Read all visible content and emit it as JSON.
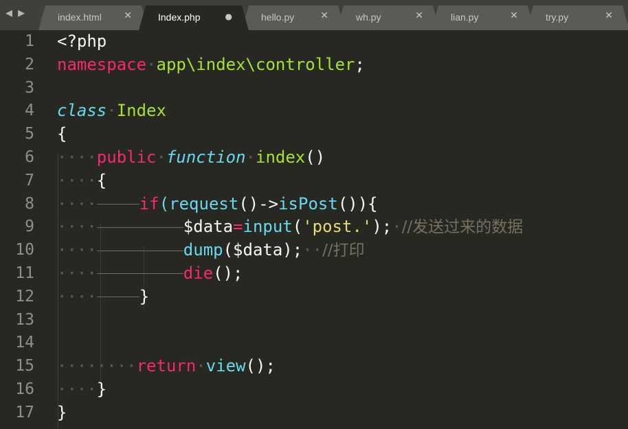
{
  "tabs": [
    {
      "label": "index.html",
      "close": "✕",
      "active": false
    },
    {
      "label": "Index.php",
      "close": "●",
      "active": true
    },
    {
      "label": "hello.py",
      "close": "✕",
      "active": false
    },
    {
      "label": "wh.py",
      "close": "✕",
      "active": false
    },
    {
      "label": "lian.py",
      "close": "✕",
      "active": false
    },
    {
      "label": "try.py",
      "close": "✕",
      "active": false
    }
  ],
  "nav": "◀ ▶",
  "line_numbers": [
    "1",
    "2",
    "3",
    "4",
    "5",
    "6",
    "7",
    "8",
    "9",
    "10",
    "11",
    "12",
    "13",
    "14",
    "15",
    "16",
    "17"
  ],
  "code": {
    "l1": "<?php",
    "l2_kw": "namespace",
    "l2_ns": "app\\index\\controller",
    "l2_end": ";",
    "l4_kw": "class",
    "l4_name": "Index",
    "l5": "{",
    "l6_kw": "public",
    "l6_fn": "function",
    "l6_name": "index",
    "l6_paren": "()",
    "l7": "{",
    "l8_if": "if",
    "l8_p1": "(",
    "l8_req": "request",
    "l8_p2": "()->",
    "l8_ispost": "isPost",
    "l8_p3": "()){",
    "l9_var": "$data",
    "l9_eq": "=",
    "l9_fn": "input",
    "l9_p1": "(",
    "l9_str": "'post.'",
    "l9_p2": ");",
    "l9_cm": "//发送过来的数据",
    "l10_fn": "dump",
    "l10_args": "($data);",
    "l10_cm": "//打印",
    "l11_fn": "die",
    "l11_end": "();",
    "l12": "}",
    "l15_kw": "return",
    "l15_fn": "view",
    "l15_end": "();",
    "l16": "}",
    "l17": "}"
  },
  "colors": {
    "background": "#272822",
    "keyword": "#f92672",
    "entity": "#a6e22e",
    "storage": "#66d9ef",
    "string": "#e6db74",
    "comment": "#75715e"
  }
}
